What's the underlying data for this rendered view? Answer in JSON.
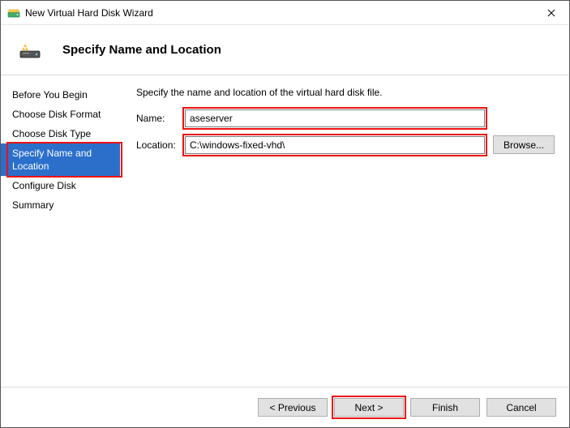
{
  "window": {
    "title": "New Virtual Hard Disk Wizard"
  },
  "header": {
    "title": "Specify Name and Location"
  },
  "sidebar": {
    "items": [
      {
        "label": "Before You Begin"
      },
      {
        "label": "Choose Disk Format"
      },
      {
        "label": "Choose Disk Type"
      },
      {
        "label": "Specify Name and Location"
      },
      {
        "label": "Configure Disk"
      },
      {
        "label": "Summary"
      }
    ],
    "active_index": 3
  },
  "content": {
    "instruction": "Specify the name and location of the virtual hard disk file.",
    "name_label": "Name:",
    "name_value": "aseserver",
    "location_label": "Location:",
    "location_value": "C:\\windows-fixed-vhd\\",
    "browse_label": "Browse..."
  },
  "footer": {
    "previous": "< Previous",
    "next": "Next >",
    "finish": "Finish",
    "cancel": "Cancel"
  },
  "highlights": {
    "step_active": true,
    "name_field": true,
    "location_field": true,
    "next_button": true
  }
}
